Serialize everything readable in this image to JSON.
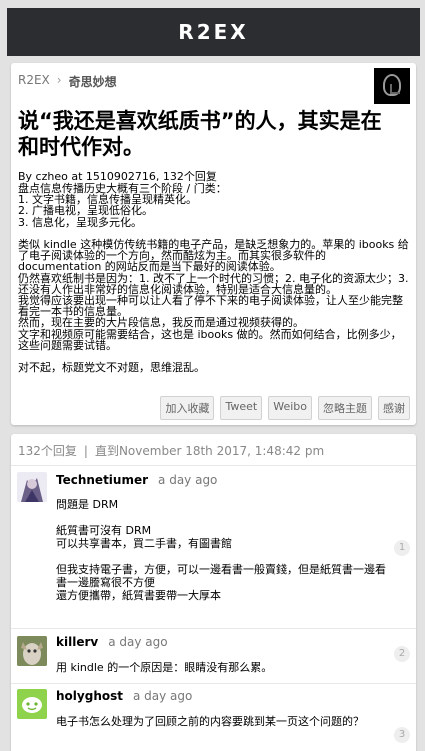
{
  "brand": "R2EX",
  "breadcrumb": {
    "root": "R2EX",
    "sep": "›",
    "node": "奇思妙想"
  },
  "topic": {
    "title": "说“我还是喜欢纸质书”的人，其实是在和时代作对。",
    "meta": "By czheo at 1510902716, 132个回复",
    "body": "盘点信息传播历史大概有三个阶段 / 门类：\n1. 文字书籍，信息传播呈现精英化。\n2. 广播电视，呈现低俗化。\n3. 信息化，呈现多元化。\n\n类似 kindle 这种模仿传统书籍的电子产品，是缺乏想象力的。苹果的 ibooks 给了电子阅读体验的一个方向，然而酷炫为主。而其实很多软件的 documentation 的网站反而是当下最好的阅读体验。\n仍然喜欢纸制书是因为：1. 改不了上一个时代的习惯；2. 电子化的资源太少；3. 还没有人作出非常好的信息化阅读体验，特别是适合大信息量的。\n我觉得应该要出现一种可以让人看了停不下来的电子阅读体验，让人至少能完整看完一本书的信息量。\n然而，现在主要的大片段信息，我反而是通过视频获得的。\n文字和视频原可能需要结合，这也是 ibooks 做的。然而如何结合，比例多少，这些问题需要试错。\n\n对不起，标题党文不对题，思维混乱。",
    "actions": [
      "加入收藏",
      "Tweet",
      "Weibo",
      "忽略主题",
      "感谢"
    ]
  },
  "replies_header": {
    "count": "132个回复",
    "sep": "|",
    "until": "直到November 18th 2017, 1:48:42 pm"
  },
  "replies": [
    {
      "user": "Technetiumer",
      "time": "a day ago",
      "content": "問題是 DRM\n\n紙質書可沒有 DRM\n可以共享書本，買二手書，有圖書館\n\n但我支持電子書，方便，可以一邊看書一般賣錢，但是紙質書一邊看書一邊謄寫很不方便\n還方便攜帶，紙質書要帶一大厚本",
      "num": "1"
    },
    {
      "user": "killerv",
      "time": "a day ago",
      "content": "用 kindle 的一个原因是：眼睛没有那么累。",
      "num": "2"
    },
    {
      "user": "holyghost",
      "time": "a day ago",
      "content": "电子书怎么处理为了回顾之前的内容要跳到某一页这个问题的？",
      "num": "3"
    }
  ]
}
